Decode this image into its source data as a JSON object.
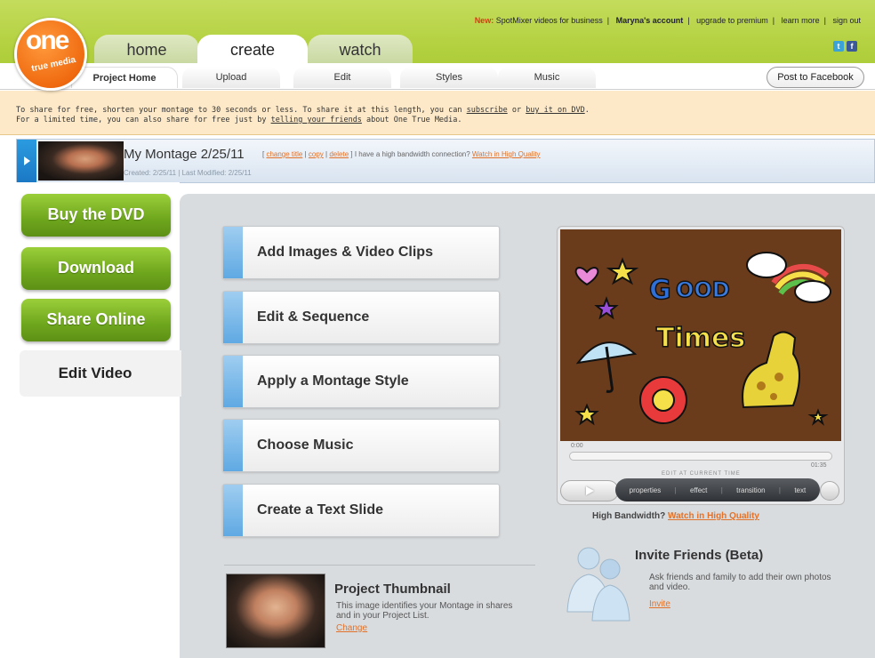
{
  "top_links": {
    "new_label": "New:",
    "spotmixer": "SpotMixer videos for business",
    "account": "Maryna's account",
    "upgrade": "upgrade to premium",
    "learn": "learn more",
    "signout": "sign out"
  },
  "logo": {
    "big": "one",
    "small": "true media"
  },
  "main_tabs": {
    "home": "home",
    "create": "create",
    "watch": "watch"
  },
  "sub_tabs": {
    "project_home": "Project Home",
    "upload": "Upload",
    "edit": "Edit",
    "styles": "Styles",
    "music": "Music"
  },
  "post_facebook": "Post to Facebook",
  "notice": {
    "line1_a": "To share for free, shorten your montage to 30 seconds or less. To share it at this length, you can ",
    "subscribe": "subscribe",
    "line1_b": " or ",
    "buy_dvd": "buy it on DVD",
    "line1_c": ".",
    "line2_a": "For a limited time, you can also share for free just by ",
    "telling": "telling your friends",
    "line2_b": " about One True Media."
  },
  "project": {
    "title": "My Montage 2/25/11",
    "change_title": "change title",
    "copy": "copy",
    "delete": "delete",
    "bandwidth_q": "I have a high bandwidth connection?",
    "watch_hq": "Watch in High Quality",
    "created_label": "Created:",
    "created_date": "2/25/11",
    "modified_label": "Last Modified:",
    "modified_date": "2/25/11"
  },
  "left_buttons": {
    "buy_dvd": "Buy the DVD",
    "download": "Download",
    "share_online": "Share Online",
    "edit_video": "Edit Video"
  },
  "steps": {
    "add": "Add Images & Video Clips",
    "edit": "Edit & Sequence",
    "style": "Apply a Montage Style",
    "music": "Choose Music",
    "text": "Create a Text Slide"
  },
  "thumbnail": {
    "title": "Project Thumbnail",
    "desc": "This image identifies your Montage in shares and in your Project List.",
    "change": "Change"
  },
  "player": {
    "time_start": "0:00",
    "time_end": "01:35",
    "edit_at": "EDIT AT CURRENT TIME",
    "properties": "properties",
    "effect": "effect",
    "transition": "transition",
    "text": "text",
    "hb_label": "High Bandwidth?",
    "hb_link": "Watch in High Quality"
  },
  "invite": {
    "title": "Invite Friends (Beta)",
    "desc": "Ask friends and family to add their own photos and video.",
    "link": "Invite"
  }
}
